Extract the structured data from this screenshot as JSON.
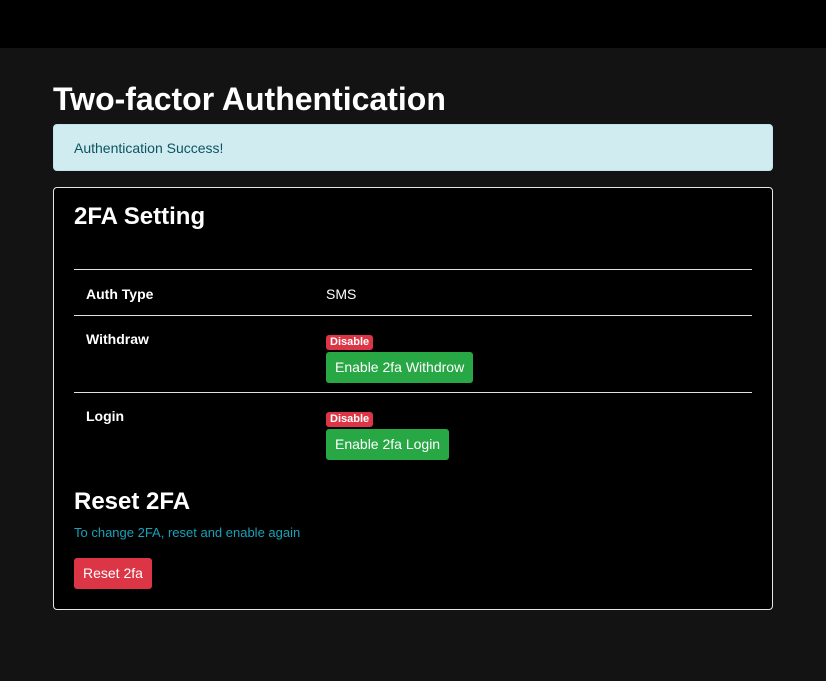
{
  "page": {
    "title": "Two-factor Authentication"
  },
  "alert": {
    "message": "Authentication Success!"
  },
  "settings": {
    "title": "2FA Setting",
    "rows": [
      {
        "label": "Auth Type",
        "value": "SMS"
      },
      {
        "label": "Withdraw",
        "status": "Disable",
        "button": "Enable 2fa Withdrow"
      },
      {
        "label": "Login",
        "status": "Disable",
        "button": "Enable 2fa Login"
      }
    ]
  },
  "reset": {
    "title": "Reset 2FA",
    "note": "To change 2FA, reset and enable again",
    "button": "Reset 2fa"
  },
  "colors": {
    "background": "#131313",
    "card": "#000000",
    "alert_bg": "#d1ecf1",
    "alert_text": "#0c5460",
    "success": "#28a745",
    "danger": "#dc3545",
    "info_text": "#17a2b8"
  }
}
